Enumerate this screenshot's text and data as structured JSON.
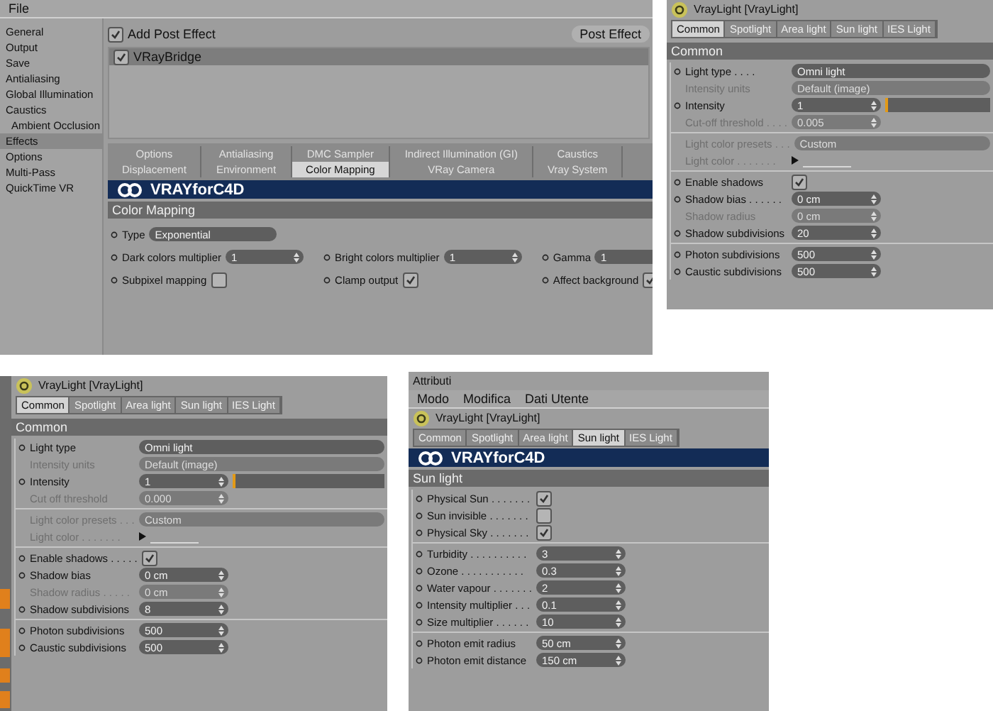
{
  "render_settings": {
    "menu": [
      "File"
    ],
    "sidebar": [
      {
        "label": "General",
        "selected": false
      },
      {
        "label": "Output",
        "selected": false
      },
      {
        "label": "Save",
        "selected": false
      },
      {
        "label": "Antialiasing",
        "selected": false
      },
      {
        "label": "Global Illumination",
        "selected": false
      },
      {
        "label": "Caustics",
        "selected": false,
        "children": [
          {
            "label": "Ambient Occlusion",
            "selected": false
          }
        ]
      },
      {
        "label": "Effects",
        "selected": true
      },
      {
        "label": "Options",
        "selected": false
      },
      {
        "label": "Multi-Pass",
        "selected": false
      },
      {
        "label": "QuickTime VR",
        "selected": false
      }
    ],
    "add_post_effect": {
      "label": "Add Post Effect",
      "checked": true
    },
    "post_effect_button": "Post Effect",
    "effects": [
      {
        "label": "VRayBridge",
        "checked": true
      }
    ],
    "tab_rows": [
      [
        {
          "label": "Options",
          "selected": false
        },
        {
          "label": "Antialiasing",
          "selected": false
        },
        {
          "label": "DMC Sampler",
          "selected": false
        },
        {
          "label": "Indirect Illumination (GI)",
          "selected": false
        },
        {
          "label": "Caustics",
          "selected": false
        }
      ],
      [
        {
          "label": "Displacement",
          "selected": false
        },
        {
          "label": "Environment",
          "selected": false
        },
        {
          "label": "Color Mapping",
          "selected": true
        },
        {
          "label": "VRay Camera",
          "selected": false
        },
        {
          "label": "Vray System",
          "selected": false
        }
      ]
    ],
    "banner": {
      "brand": "VRAY",
      "connector": "for",
      "product": "C4D"
    },
    "section": "Color Mapping",
    "rows": [
      [
        {
          "label": "Type",
          "kind": "dropdown",
          "value": "Exponential"
        }
      ],
      [
        {
          "label": "Dark colors multiplier",
          "kind": "number",
          "value": "1"
        },
        {
          "label": "Bright colors multiplier",
          "kind": "number",
          "value": "1"
        },
        {
          "label": "Gamma",
          "kind": "number",
          "value": "1"
        }
      ],
      [
        {
          "label": "Subpixel mapping",
          "kind": "checkbox",
          "checked": false
        },
        {
          "label": "Clamp output",
          "kind": "checkbox",
          "checked": true
        },
        {
          "label": "Affect background",
          "kind": "checkbox",
          "checked": true
        }
      ]
    ]
  },
  "light_panels": [
    {
      "title": "VrayLight [VrayLight]",
      "tabs": [
        {
          "label": "Common",
          "selected": true
        },
        {
          "label": "Spotlight",
          "selected": false
        },
        {
          "label": "Area light",
          "selected": false
        },
        {
          "label": "Sun light",
          "selected": false
        },
        {
          "label": "IES Light",
          "selected": false
        }
      ],
      "section": "Common",
      "groups": [
        [
          {
            "label": "Light type . . . .",
            "kind": "dropdown",
            "value": "Omni light",
            "disabled": false
          },
          {
            "label": "Intensity units",
            "kind": "dropdown",
            "value": "Default (image)",
            "disabled": true
          },
          {
            "label": "Intensity",
            "kind": "slider",
            "value": "1",
            "level": 0,
            "disabled": false
          },
          {
            "label": "Cut-off threshold . . . .",
            "kind": "number",
            "value": "0.005",
            "disabled": true
          }
        ],
        [
          {
            "label": "Light color presets . . .",
            "kind": "dropdown",
            "value": "Custom",
            "disabled": true
          },
          {
            "label": "Light color . . . . . . .",
            "kind": "color",
            "disabled": true
          }
        ],
        [
          {
            "label": "Enable shadows",
            "kind": "checkbox",
            "checked": true,
            "disabled": false
          },
          {
            "label": "Shadow bias . . . . . .",
            "kind": "number",
            "value": "0 cm",
            "disabled": false
          },
          {
            "label": "Shadow radius",
            "kind": "number",
            "value": "0 cm",
            "disabled": true
          },
          {
            "label": "Shadow subdivisions",
            "kind": "number",
            "value": "20",
            "disabled": false
          }
        ],
        [
          {
            "label": "Photon subdivisions",
            "kind": "number",
            "value": "500",
            "disabled": false
          },
          {
            "label": "Caustic subdivisions",
            "kind": "number",
            "value": "500",
            "disabled": false
          }
        ]
      ]
    },
    {
      "title": "VrayLight [VrayLight]",
      "tabs": [
        {
          "label": "Common",
          "selected": true
        },
        {
          "label": "Spotlight",
          "selected": false
        },
        {
          "label": "Area light",
          "selected": false
        },
        {
          "label": "Sun light",
          "selected": false
        },
        {
          "label": "IES Light",
          "selected": false
        }
      ],
      "section": "Common",
      "groups": [
        [
          {
            "label": "Light type",
            "kind": "dropdown",
            "value": "Omni light",
            "disabled": false
          },
          {
            "label": "Intensity units",
            "kind": "dropdown",
            "value": "Default (image)",
            "disabled": true
          },
          {
            "label": "Intensity",
            "kind": "slider",
            "value": "1",
            "level": 0,
            "disabled": false
          },
          {
            "label": "Cut off threshold",
            "kind": "number",
            "value": "0.000",
            "disabled": true
          }
        ],
        [
          {
            "label": "Light color presets . . .",
            "kind": "dropdown",
            "value": "Custom",
            "disabled": true
          },
          {
            "label": "Light color . . . . . . .",
            "kind": "color",
            "disabled": true
          }
        ],
        [
          {
            "label": "Enable shadows . . . . .",
            "kind": "checkbox",
            "checked": true,
            "disabled": false
          },
          {
            "label": "Shadow bias",
            "kind": "number",
            "value": "0 cm",
            "disabled": false
          },
          {
            "label": "Shadow radius . . . . .",
            "kind": "number",
            "value": "0 cm",
            "disabled": true
          },
          {
            "label": "Shadow subdivisions",
            "kind": "number",
            "value": "8",
            "disabled": false
          }
        ],
        [
          {
            "label": "Photon subdivisions",
            "kind": "number",
            "value": "500",
            "disabled": false
          },
          {
            "label": "Caustic subdivisions",
            "kind": "number",
            "value": "500",
            "disabled": false
          }
        ]
      ]
    },
    {
      "window_title": "Attributi",
      "menu": [
        "Modo",
        "Modifica",
        "Dati Utente"
      ],
      "title": "VrayLight [VrayLight]",
      "tabs": [
        {
          "label": "Common",
          "selected": false
        },
        {
          "label": "Spotlight",
          "selected": false
        },
        {
          "label": "Area light",
          "selected": false
        },
        {
          "label": "Sun light",
          "selected": true
        },
        {
          "label": "IES Light",
          "selected": false
        }
      ],
      "banner": {
        "brand": "VRAY",
        "connector": "for",
        "product": "C4D"
      },
      "section": "Sun light",
      "groups": [
        [
          {
            "label": "Physical Sun . . . . . . .",
            "kind": "checkbox",
            "checked": true,
            "disabled": false
          },
          {
            "label": "Sun invisible . . . . . . .",
            "kind": "checkbox",
            "checked": false,
            "disabled": false
          },
          {
            "label": "Physical Sky . . . . . . .",
            "kind": "checkbox",
            "checked": true,
            "disabled": false
          }
        ],
        [
          {
            "label": "Turbidity . . . . . . . . . .",
            "kind": "number",
            "value": "3",
            "disabled": false
          },
          {
            "label": "Ozone . . . . . . . . . . .",
            "kind": "number",
            "value": "0.3",
            "disabled": false
          },
          {
            "label": "Water vapour . . . . . . .",
            "kind": "number",
            "value": "2",
            "disabled": false
          },
          {
            "label": "Intensity multiplier . . .",
            "kind": "number",
            "value": "0.1",
            "disabled": false
          },
          {
            "label": "Size multiplier . . . . . .",
            "kind": "number",
            "value": "10",
            "disabled": false
          }
        ],
        [
          {
            "label": "Photon emit radius",
            "kind": "number",
            "value": "50 cm",
            "disabled": false
          },
          {
            "label": "Photon emit distance",
            "kind": "number",
            "value": "150 cm",
            "disabled": false
          }
        ]
      ]
    }
  ]
}
